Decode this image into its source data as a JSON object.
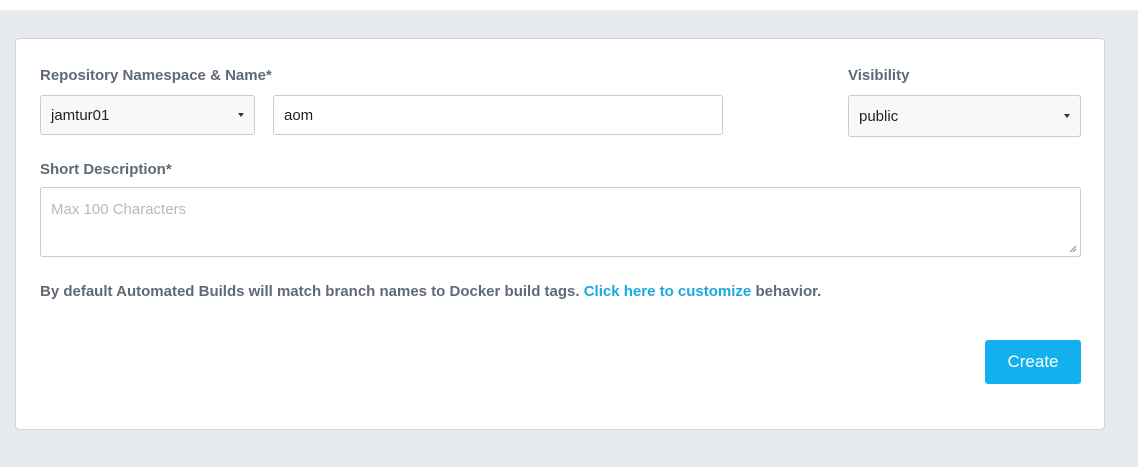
{
  "form": {
    "repo_label": "Repository Namespace & Name*",
    "namespace_value": "jamtur01",
    "name_value": "aom",
    "visibility_label": "Visibility",
    "visibility_value": "public",
    "description_label": "Short Description*",
    "description_placeholder": "Max 100 Characters",
    "info_prefix": "By default Automated Builds will match branch names to Docker build tags.",
    "info_link": "Click here to customize",
    "info_suffix": "behavior.",
    "create_label": "Create"
  },
  "icons": {
    "namespace_dropdown": "chevron-down-icon",
    "visibility_dropdown": "chevron-down-icon",
    "resize": "resize-grip-icon"
  },
  "colors": {
    "accent": "#12b0ee",
    "link": "#1aa9e0",
    "label_text": "#5f6a76",
    "page_background": "#e7ebef"
  }
}
